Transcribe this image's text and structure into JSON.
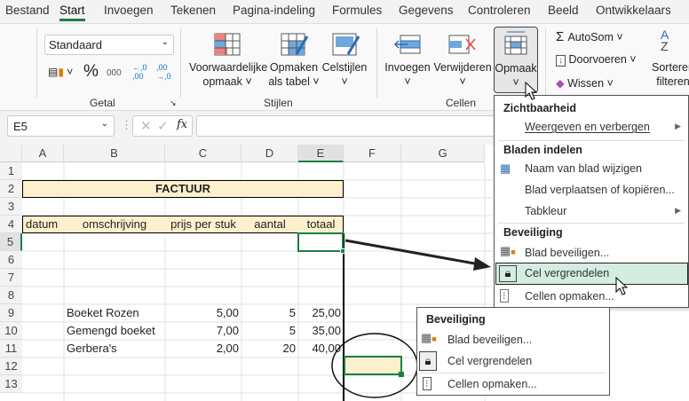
{
  "tabs": [
    "Bestand",
    "Start",
    "Invoegen",
    "Tekenen",
    "Pagina-indeling",
    "Formules",
    "Gegevens",
    "Controleren",
    "Beeld",
    "Ontwikkelaars"
  ],
  "active_tab": "Start",
  "ribbon": {
    "number_format": "Standaard",
    "percent": "%",
    "thousands": "000",
    "dec_inc": "←,0 ,00",
    "dec_dec": ",00 →,0",
    "getal_label": "Getal",
    "cond_format": [
      "Voorwaardelijke",
      "opmaak ˅"
    ],
    "format_table": [
      "Opmaken",
      "als tabel ˅"
    ],
    "cell_styles": [
      "Celstijlen",
      "˅"
    ],
    "stijlen_label": "Stijlen",
    "insert": [
      "Invoegen",
      "˅"
    ],
    "delete": [
      "Verwijderen",
      "˅"
    ],
    "format": [
      "Opmaak",
      "˅"
    ],
    "cellen_label": "Cellen",
    "autosum": "AutoSom ˅",
    "fill": "Doorvoeren ˅",
    "clear": "Wissen ˅",
    "sort": [
      "Sorteren",
      "filteren"
    ]
  },
  "formula_bar": {
    "name_box": "E5",
    "fx": "fx",
    "value": ""
  },
  "columns": [
    "A",
    "B",
    "C",
    "D",
    "E",
    "F",
    "G"
  ],
  "rows": [
    "1",
    "2",
    "3",
    "4",
    "5",
    "6",
    "7",
    "8",
    "9",
    "10",
    "11",
    "12",
    "13"
  ],
  "sheet": {
    "title": "FACTUUR",
    "headers": [
      "datum",
      "omschrijving",
      "prijs per stuk",
      "aantal",
      "totaal"
    ],
    "items": [
      {
        "desc": "Boeket Rozen",
        "price": "5,00",
        "qty": "5",
        "total": "25,00"
      },
      {
        "desc": "Gemengd boeket",
        "price": "7,00",
        "qty": "5",
        "total": "35,00"
      },
      {
        "desc": "Gerbera's",
        "price": "2,00",
        "qty": "20",
        "total": "40,00"
      }
    ]
  },
  "menu": {
    "h1": "Zichtbaarheid",
    "show_hide": "Weergeven en verbergen",
    "h2": "Bladen indelen",
    "rename": "Naam van blad wijzigen",
    "move": "Blad verplaatsen of kopiëren...",
    "tabcolor": "Tabkleur",
    "h3": "Beveiliging",
    "protect": "Blad beveiligen...",
    "lock": "Cel vergrendelen",
    "format_cells": "Cellen opmaken..."
  },
  "inset": {
    "h": "Beveiliging",
    "protect": "Blad beveiligen...",
    "lock": "Cel vergrendelen",
    "format_cells": "Cellen opmaken..."
  },
  "colors": {
    "accent": "#1d7d45",
    "header_fill": "#fdf0cc",
    "highlight": "#d3ede0"
  }
}
